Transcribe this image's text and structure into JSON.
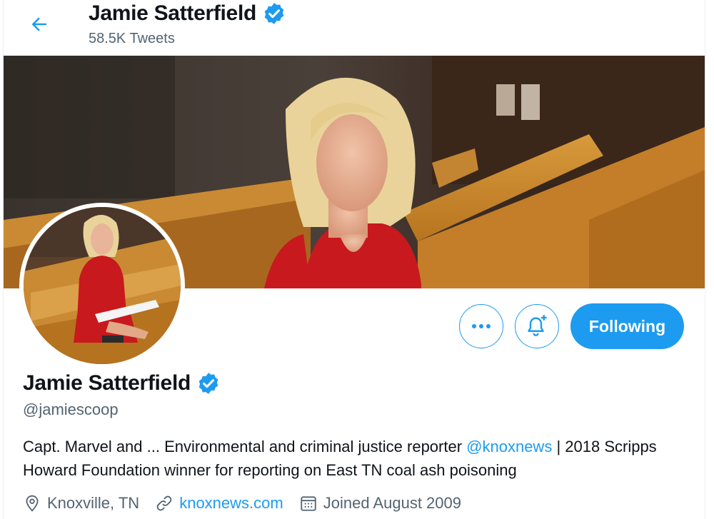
{
  "header": {
    "name": "Jamie Satterfield",
    "tweet_count": "58.5K Tweets"
  },
  "profile": {
    "name": "Jamie Satterfield",
    "handle": "@jamiescoop",
    "bio_prefix": "Capt. Marvel and ... Environmental and criminal justice reporter ",
    "bio_mention": "@knoxnews",
    "bio_suffix": " | 2018 Scripps Howard Foundation winner for reporting on East TN coal ash poisoning",
    "location": "Knoxville, TN",
    "website": "knoxnews.com",
    "joined": "Joined August 2009"
  },
  "actions": {
    "following_label": "Following"
  },
  "colors": {
    "accent": "#1d9bf0",
    "text": "#0f1419",
    "secondary": "#536471",
    "dress": "#c8191e"
  },
  "icons": [
    "back-arrow-icon",
    "verified-badge-icon",
    "more-icon",
    "notify-bell-plus-icon",
    "location-pin-icon",
    "link-icon",
    "calendar-icon"
  ]
}
